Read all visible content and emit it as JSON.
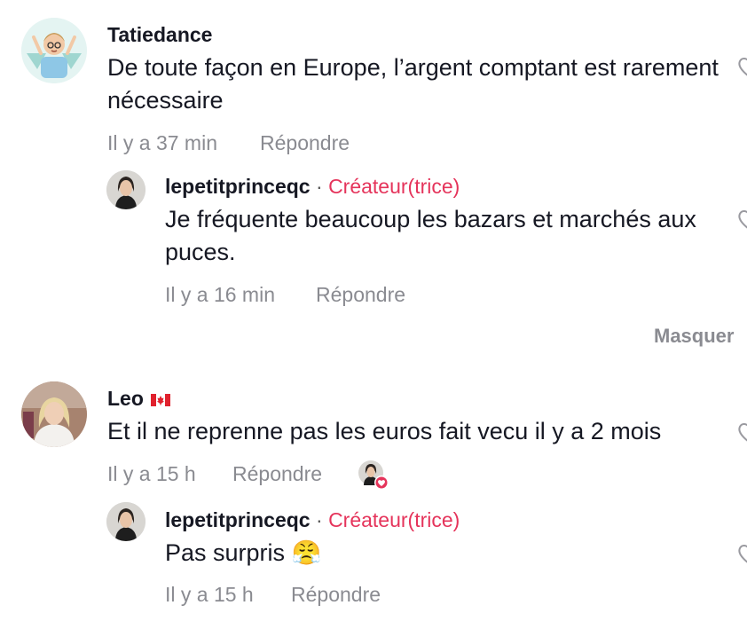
{
  "comments": [
    {
      "username": "Tatiedance",
      "text": "De toute façon en Europe, l’argent comptant est rarement nécessaire",
      "time": "Il y a 37 min",
      "reply_label": "Répondre",
      "replies": [
        {
          "username": "lepetitprinceqc",
          "separator": "·",
          "badge": "Créateur(trice)",
          "text": "Je fréquente beaucoup les bazars et marchés aux puces.",
          "time": "Il y a 16 min",
          "reply_label": "Répondre"
        }
      ],
      "hide_label": "Masquer"
    },
    {
      "username": "Leo",
      "username_flag": "canada-flag",
      "text": "Et il ne reprenne pas les euros fait vecu il y a 2 mois",
      "time": "Il y a 15 h",
      "reply_label": "Répondre",
      "replies": [
        {
          "username": "lepetitprinceqc",
          "separator": "·",
          "badge": "Créateur(trice)",
          "text": "Pas surpris 😤",
          "time": "Il y a 15 h",
          "reply_label": "Répondre"
        }
      ]
    }
  ],
  "colors": {
    "creator_badge": "#e5345b",
    "meta_gray": "#8a8b91",
    "text": "#161823"
  }
}
